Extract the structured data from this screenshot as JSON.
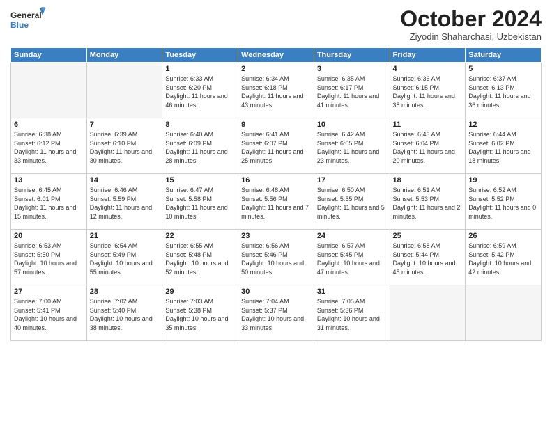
{
  "header": {
    "logo_general": "General",
    "logo_blue": "Blue",
    "month_title": "October 2024",
    "subtitle": "Ziyodin Shaharchasi, Uzbekistan"
  },
  "days_of_week": [
    "Sunday",
    "Monday",
    "Tuesday",
    "Wednesday",
    "Thursday",
    "Friday",
    "Saturday"
  ],
  "weeks": [
    [
      {
        "day": "",
        "empty": true
      },
      {
        "day": "",
        "empty": true
      },
      {
        "day": "1",
        "sunrise": "6:33 AM",
        "sunset": "6:20 PM",
        "daylight": "11 hours and 46 minutes."
      },
      {
        "day": "2",
        "sunrise": "6:34 AM",
        "sunset": "6:18 PM",
        "daylight": "11 hours and 43 minutes."
      },
      {
        "day": "3",
        "sunrise": "6:35 AM",
        "sunset": "6:17 PM",
        "daylight": "11 hours and 41 minutes."
      },
      {
        "day": "4",
        "sunrise": "6:36 AM",
        "sunset": "6:15 PM",
        "daylight": "11 hours and 38 minutes."
      },
      {
        "day": "5",
        "sunrise": "6:37 AM",
        "sunset": "6:13 PM",
        "daylight": "11 hours and 36 minutes."
      }
    ],
    [
      {
        "day": "6",
        "sunrise": "6:38 AM",
        "sunset": "6:12 PM",
        "daylight": "11 hours and 33 minutes."
      },
      {
        "day": "7",
        "sunrise": "6:39 AM",
        "sunset": "6:10 PM",
        "daylight": "11 hours and 30 minutes."
      },
      {
        "day": "8",
        "sunrise": "6:40 AM",
        "sunset": "6:09 PM",
        "daylight": "11 hours and 28 minutes."
      },
      {
        "day": "9",
        "sunrise": "6:41 AM",
        "sunset": "6:07 PM",
        "daylight": "11 hours and 25 minutes."
      },
      {
        "day": "10",
        "sunrise": "6:42 AM",
        "sunset": "6:05 PM",
        "daylight": "11 hours and 23 minutes."
      },
      {
        "day": "11",
        "sunrise": "6:43 AM",
        "sunset": "6:04 PM",
        "daylight": "11 hours and 20 minutes."
      },
      {
        "day": "12",
        "sunrise": "6:44 AM",
        "sunset": "6:02 PM",
        "daylight": "11 hours and 18 minutes."
      }
    ],
    [
      {
        "day": "13",
        "sunrise": "6:45 AM",
        "sunset": "6:01 PM",
        "daylight": "11 hours and 15 minutes."
      },
      {
        "day": "14",
        "sunrise": "6:46 AM",
        "sunset": "5:59 PM",
        "daylight": "11 hours and 12 minutes."
      },
      {
        "day": "15",
        "sunrise": "6:47 AM",
        "sunset": "5:58 PM",
        "daylight": "11 hours and 10 minutes."
      },
      {
        "day": "16",
        "sunrise": "6:48 AM",
        "sunset": "5:56 PM",
        "daylight": "11 hours and 7 minutes."
      },
      {
        "day": "17",
        "sunrise": "6:50 AM",
        "sunset": "5:55 PM",
        "daylight": "11 hours and 5 minutes."
      },
      {
        "day": "18",
        "sunrise": "6:51 AM",
        "sunset": "5:53 PM",
        "daylight": "11 hours and 2 minutes."
      },
      {
        "day": "19",
        "sunrise": "6:52 AM",
        "sunset": "5:52 PM",
        "daylight": "11 hours and 0 minutes."
      }
    ],
    [
      {
        "day": "20",
        "sunrise": "6:53 AM",
        "sunset": "5:50 PM",
        "daylight": "10 hours and 57 minutes."
      },
      {
        "day": "21",
        "sunrise": "6:54 AM",
        "sunset": "5:49 PM",
        "daylight": "10 hours and 55 minutes."
      },
      {
        "day": "22",
        "sunrise": "6:55 AM",
        "sunset": "5:48 PM",
        "daylight": "10 hours and 52 minutes."
      },
      {
        "day": "23",
        "sunrise": "6:56 AM",
        "sunset": "5:46 PM",
        "daylight": "10 hours and 50 minutes."
      },
      {
        "day": "24",
        "sunrise": "6:57 AM",
        "sunset": "5:45 PM",
        "daylight": "10 hours and 47 minutes."
      },
      {
        "day": "25",
        "sunrise": "6:58 AM",
        "sunset": "5:44 PM",
        "daylight": "10 hours and 45 minutes."
      },
      {
        "day": "26",
        "sunrise": "6:59 AM",
        "sunset": "5:42 PM",
        "daylight": "10 hours and 42 minutes."
      }
    ],
    [
      {
        "day": "27",
        "sunrise": "7:00 AM",
        "sunset": "5:41 PM",
        "daylight": "10 hours and 40 minutes."
      },
      {
        "day": "28",
        "sunrise": "7:02 AM",
        "sunset": "5:40 PM",
        "daylight": "10 hours and 38 minutes."
      },
      {
        "day": "29",
        "sunrise": "7:03 AM",
        "sunset": "5:38 PM",
        "daylight": "10 hours and 35 minutes."
      },
      {
        "day": "30",
        "sunrise": "7:04 AM",
        "sunset": "5:37 PM",
        "daylight": "10 hours and 33 minutes."
      },
      {
        "day": "31",
        "sunrise": "7:05 AM",
        "sunset": "5:36 PM",
        "daylight": "10 hours and 31 minutes."
      },
      {
        "day": "",
        "empty": true
      },
      {
        "day": "",
        "empty": true
      }
    ]
  ]
}
